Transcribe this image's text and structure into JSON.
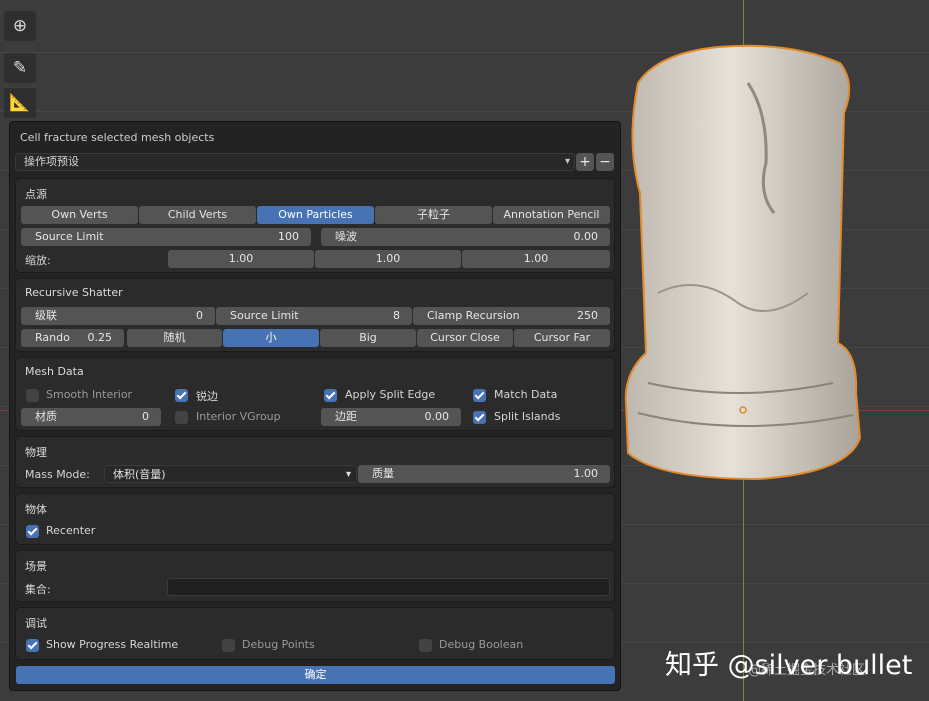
{
  "panel": {
    "title": "Cell fracture selected mesh objects",
    "presets": {
      "value": "操作项预设",
      "add": "+",
      "remove": "−"
    },
    "source": {
      "header": "点源",
      "options": [
        "Own Verts",
        "Child Verts",
        "Own Particles",
        "子粒子",
        "Annotation Pencil"
      ],
      "active": "Own Particles",
      "source_limit": {
        "label": "Source Limit",
        "value": "100"
      },
      "noise": {
        "label": "噪波",
        "value": "0.00"
      },
      "scale": {
        "label": "缩放:",
        "x": "1.00",
        "y": "1.00",
        "z": "1.00"
      }
    },
    "recursive": {
      "header": "Recursive Shatter",
      "recursion": {
        "label": "级联",
        "value": "0"
      },
      "source_limit": {
        "label": "Source Limit",
        "value": "8"
      },
      "clamp": {
        "label": "Clamp Recursion",
        "value": "250"
      },
      "random": {
        "label": "Rando",
        "value": "0.25"
      },
      "methods": [
        "随机",
        "小",
        "Big",
        "Cursor Close",
        "Cursor Far"
      ],
      "active_method": "小"
    },
    "mesh": {
      "header": "Mesh Data",
      "smooth_interior": "Smooth Interior",
      "sharp_edges": "锐边",
      "apply_split_edge": "Apply Split Edge",
      "match_data": "Match Data",
      "material": {
        "label": "材质",
        "value": "0"
      },
      "interior_vgroup": "Interior VGroup",
      "margin": {
        "label": "边距",
        "value": "0.00"
      },
      "split_islands": "Split Islands"
    },
    "physics": {
      "header": "物理",
      "mass_mode_label": "Mass Mode:",
      "mass_mode_value": "体积(音量)",
      "mass": {
        "label": "质量",
        "value": "1.00"
      }
    },
    "object": {
      "header": "物体",
      "recenter": "Recenter"
    },
    "scene": {
      "header": "场景",
      "collection_label": "集合:",
      "collection_value": ""
    },
    "debug": {
      "header": "调试",
      "show_progress": "Show Progress Realtime",
      "debug_points": "Debug Points",
      "debug_boolean": "Debug Boolean"
    },
    "ok": "确定"
  },
  "toolbar": {
    "icons": [
      "transform-icon",
      "annotate-icon",
      "measure-icon"
    ]
  },
  "watermark": {
    "main": "知乎 @silver bullet",
    "sub": "@稀土掘金技术社区"
  },
  "colors": {
    "accent": "#4772b3",
    "panel_bg": "#232323",
    "box_bg": "#2b2b2b",
    "button": "#545454"
  }
}
